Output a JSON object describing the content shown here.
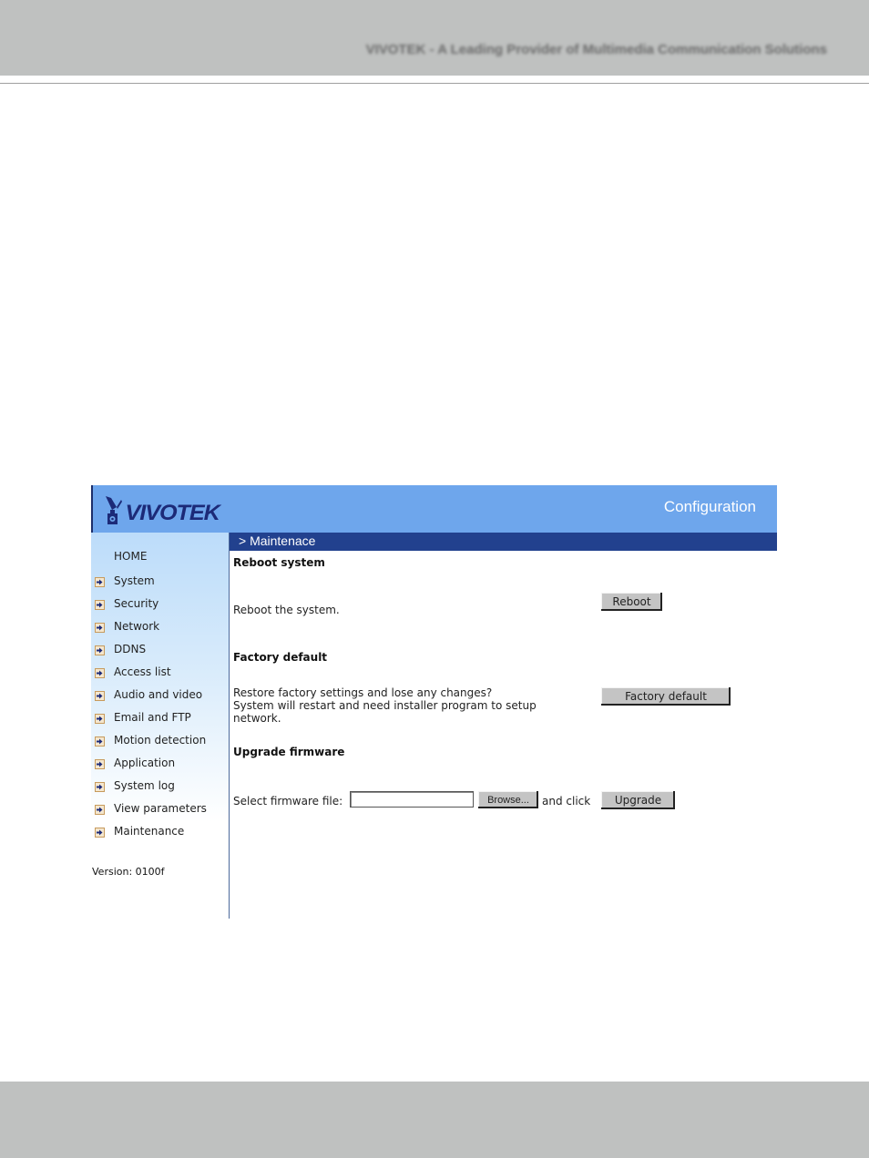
{
  "document": {
    "header_tagline": "VIVOTEK - A Leading Provider of Multimedia Communication Solutions",
    "colors": {
      "banner_gray": "#bfc1c0"
    }
  },
  "app": {
    "brand": "VIVOTEK",
    "title": "Configuration",
    "breadcrumb": "> Maintenace",
    "colors": {
      "header": "#6ea6ec",
      "breadcrumb_bar": "#22418e",
      "brand_text": "#1c2a78"
    }
  },
  "sidebar": {
    "home": "HOME",
    "items": [
      {
        "label": "System"
      },
      {
        "label": "Security"
      },
      {
        "label": "Network"
      },
      {
        "label": "DDNS"
      },
      {
        "label": "Access list"
      },
      {
        "label": "Audio and video"
      },
      {
        "label": "Email and FTP"
      },
      {
        "label": "Motion detection"
      },
      {
        "label": "Application"
      },
      {
        "label": "System log"
      },
      {
        "label": "View parameters"
      },
      {
        "label": "Maintenance"
      }
    ],
    "version": "Version: 0100f"
  },
  "content": {
    "reboot": {
      "title": "Reboot system",
      "description": "Reboot the system.",
      "button": "Reboot"
    },
    "factory": {
      "title": "Factory default",
      "description_lines": [
        "Restore factory settings and lose any changes?",
        "System will restart and need installer program to setup",
        "network."
      ],
      "button": "Factory default"
    },
    "upgrade": {
      "title": "Upgrade firmware",
      "select_label": "Select firmware file:",
      "file_value": "",
      "browse_button": "Browse...",
      "and_click": "and click",
      "button": "Upgrade"
    }
  }
}
